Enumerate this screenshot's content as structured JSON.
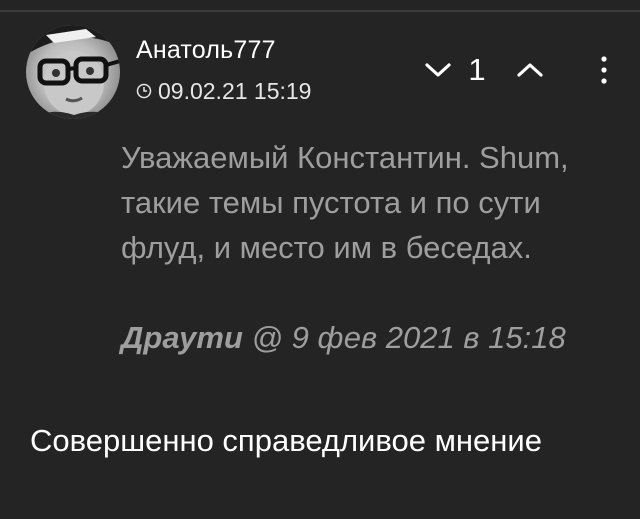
{
  "comment": {
    "username": "Анатоль777",
    "timestamp": "09.02.21 15:19",
    "vote_count": "1",
    "quote": {
      "text": "Уважаемый Константин. Shum, такие темы пустота и по сути флуд, и место им в беседах.",
      "author": "Драути",
      "attribution": " @ 9 фев 2021 в 15:18"
    },
    "reply_text": "Совершенно справедливое мнение"
  },
  "icons": {
    "clock": "clock-icon",
    "downvote": "chevron-down-icon",
    "upvote": "chevron-up-icon",
    "menu": "more-vertical-icon"
  },
  "colors": {
    "background": "#242424",
    "text_primary": "#ffffff",
    "text_quote": "#9e9e9e"
  }
}
